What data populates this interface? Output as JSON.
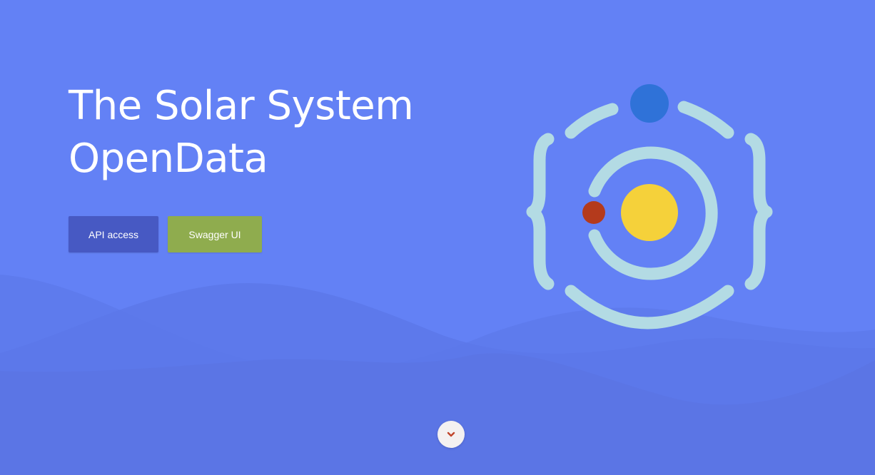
{
  "hero": {
    "title_line1": "The Solar System",
    "title_line2": "OpenData"
  },
  "actions": {
    "api_label": "API access",
    "swagger_label": "Swagger UI"
  },
  "colors": {
    "background": "#6381f5",
    "api_button": "#4759c3",
    "swagger_button": "#8fac4e",
    "logo_ring": "#b3dbe4",
    "sun": "#f5d13a",
    "planet_red": "#b43a1c",
    "planet_blue": "#2f72d8",
    "scroll_chevron": "#c0452b"
  },
  "icons": {
    "logo": "solar-system-braces-logo",
    "scroll": "chevron-down-icon"
  }
}
